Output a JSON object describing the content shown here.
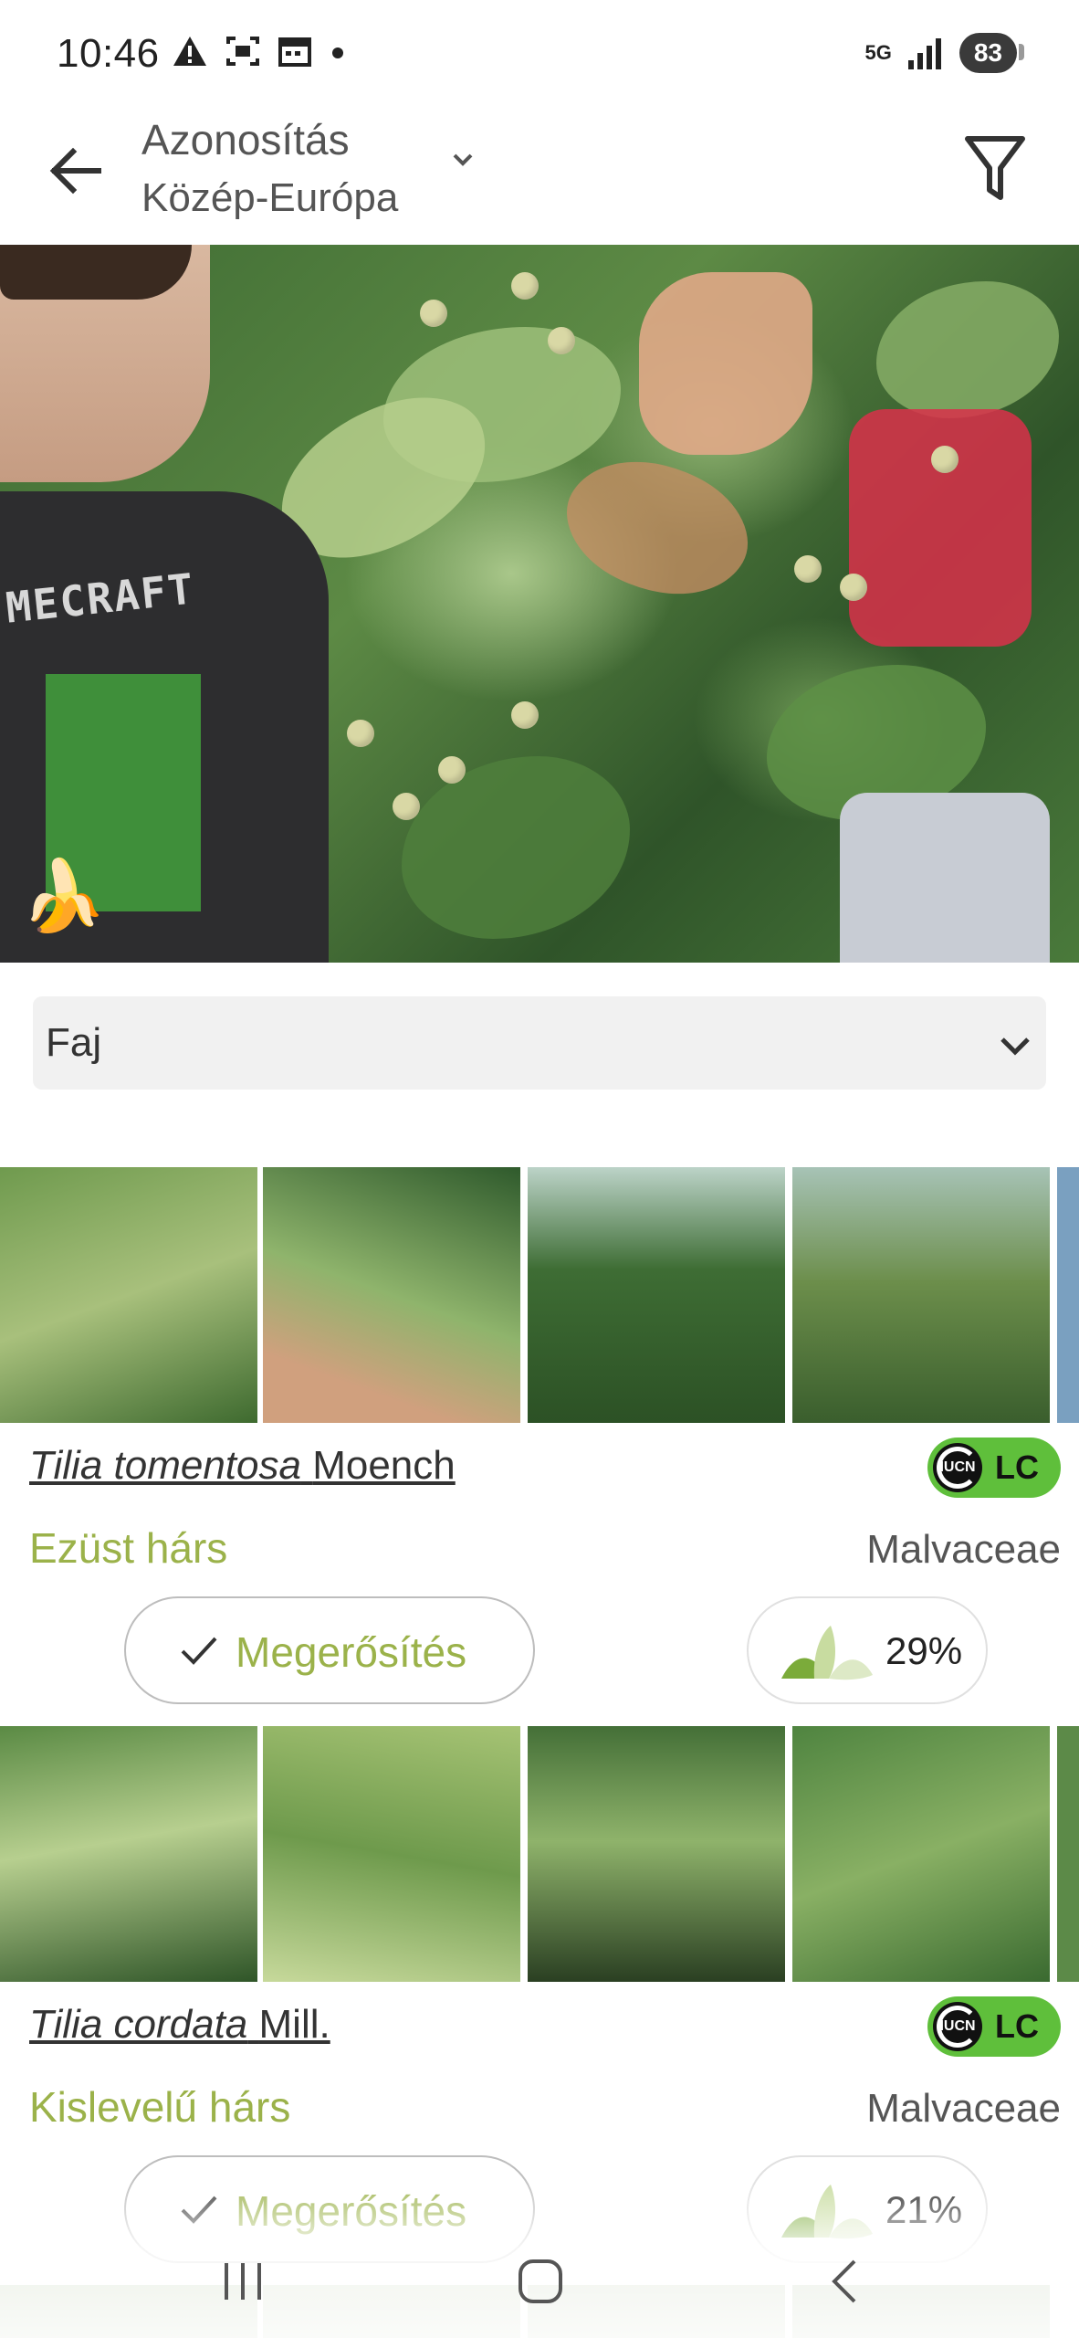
{
  "status_bar": {
    "time": "10:46",
    "network": "5G",
    "battery": "83",
    "icons": [
      "warning-icon",
      "screenshot-icon",
      "calendar-icon",
      "dot-icon",
      "signal-icon"
    ]
  },
  "app_bar": {
    "title": "Azonosítás",
    "subtitle": "Közép-Európa",
    "back_icon": "arrow-back-icon",
    "filter_icon": "filter-icon"
  },
  "photo": {
    "shirt_text": "MECRAFT",
    "badge_icon": "banana-icon"
  },
  "rank_dropdown": {
    "value": "Faj"
  },
  "results": [
    {
      "scientific_name": "Tilia tomentosa",
      "author": "Moench",
      "common_name": "Ezüst hárs",
      "family": "Malvaceae",
      "iucn_status": "LC",
      "iucn_logo_text": "IUCN",
      "confirm_label": "Megerősítés",
      "score": "29%"
    },
    {
      "scientific_name": "Tilia cordata",
      "author": "Mill.",
      "common_name": "Kislevelű hárs",
      "family": "Malvaceae",
      "iucn_status": "LC",
      "iucn_logo_text": "IUCN",
      "confirm_label": "Megerősítés",
      "score": "21%"
    }
  ],
  "colors": {
    "accent_green": "#9bb24a",
    "iucn_green": "#5fbf3b",
    "text_gray": "#555555"
  }
}
